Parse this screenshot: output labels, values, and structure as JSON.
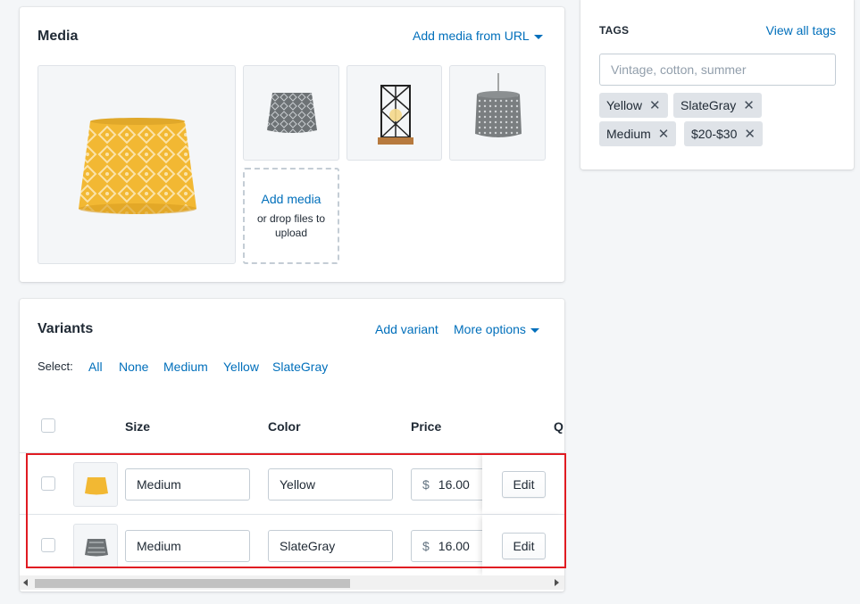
{
  "media": {
    "title": "Media",
    "add_from_url": "Add media from URL",
    "drop_zone": {
      "title": "Add media",
      "subtitle": "or drop files to upload"
    }
  },
  "variants": {
    "title": "Variants",
    "add_variant": "Add variant",
    "more_options": "More options",
    "select": {
      "label": "Select:",
      "options": [
        "All",
        "None",
        "Medium",
        "Yellow",
        "SlateGray"
      ]
    },
    "columns": [
      "Size",
      "Color",
      "Price",
      "Q"
    ],
    "rows": [
      {
        "size": "Medium",
        "color": "Yellow",
        "currency": "$",
        "price": "16.00",
        "action": "Edit"
      },
      {
        "size": "Medium",
        "color": "SlateGray",
        "currency": "$",
        "price": "16.00",
        "action": "Edit"
      }
    ]
  },
  "tags": {
    "title": "TAGS",
    "view_all": "View all tags",
    "input_placeholder": "Vintage, cotton, summer",
    "items": [
      "Yellow",
      "SlateGray",
      "Medium",
      "$20-$30"
    ]
  },
  "colors": {
    "link": "#006fbb",
    "highlight": "#e01b22",
    "yellow_shade": "#f2b833",
    "slate_shade": "#6d7275"
  }
}
